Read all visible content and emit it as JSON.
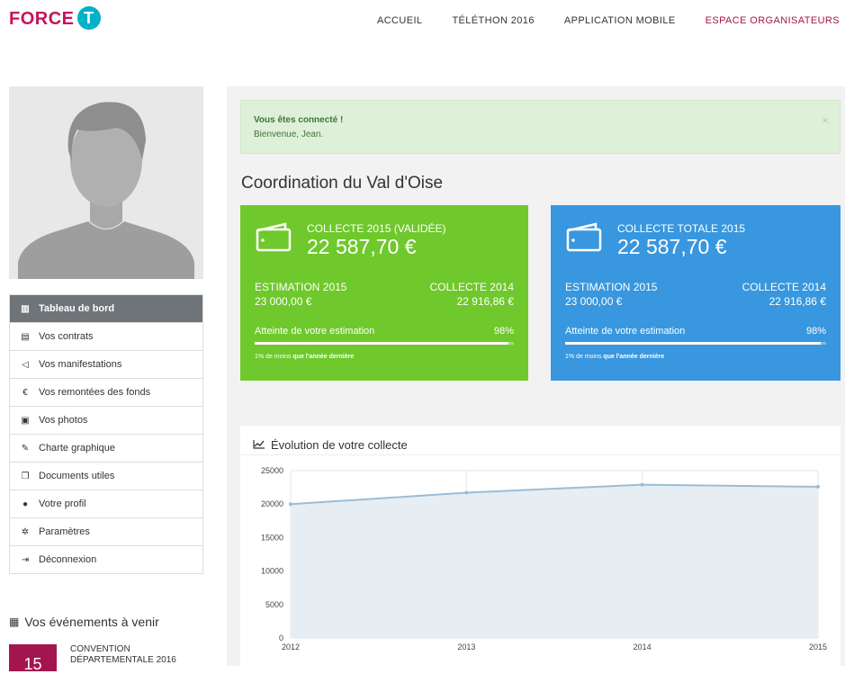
{
  "header": {
    "logo_text": "FORCE",
    "logo_badge": "T",
    "nav": [
      {
        "label": "ACCUEIL",
        "active": false
      },
      {
        "label": "TÉLÉTHON 2016",
        "active": false
      },
      {
        "label": "APPLICATION MOBILE",
        "active": false
      },
      {
        "label": "ESPACE ORGANISATEURS",
        "active": true
      }
    ]
  },
  "sidebar": {
    "menu": [
      {
        "label": "Tableau de bord",
        "icon": "bar-chart-icon",
        "active": true
      },
      {
        "label": "Vos contrats",
        "icon": "document-icon",
        "active": false
      },
      {
        "label": "Vos manifestations",
        "icon": "megaphone-icon",
        "active": false
      },
      {
        "label": "Vos remontées des fonds",
        "icon": "euro-icon",
        "active": false
      },
      {
        "label": "Vos photos",
        "icon": "image-icon",
        "active": false
      },
      {
        "label": "Charte graphique",
        "icon": "brush-icon",
        "active": false
      },
      {
        "label": "Documents utiles",
        "icon": "copy-icon",
        "active": false
      },
      {
        "label": "Votre profil",
        "icon": "user-icon",
        "active": false
      },
      {
        "label": "Paramètres",
        "icon": "gear-icon",
        "active": false
      },
      {
        "label": "Déconnexion",
        "icon": "logout-icon",
        "active": false
      }
    ],
    "events_title": "Vos événements à venir",
    "event": {
      "day": "15",
      "title_line1": "CONVENTION",
      "title_line2": "DÉPARTEMENTALE 2016"
    }
  },
  "main": {
    "alert": {
      "title": "Vous êtes connecté !",
      "message": "Bienvenue, Jean.",
      "close": "×"
    },
    "page_title": "Coordination du Val d'Oise",
    "cards": [
      {
        "label": "COLLECTE 2015 (VALIDÉE)",
        "amount": "22 587,70 €",
        "est_label": "ESTIMATION 2015",
        "est_value": "23 000,00 €",
        "prev_label": "COLLECTE 2014",
        "prev_value": "22 916,86 €",
        "att_label": "Atteinte de votre estimation",
        "att_pct": "98%",
        "progress": 0.98,
        "note_plain": "1% de moins ",
        "note_bold": "que l'année dernière"
      },
      {
        "label": "COLLECTE TOTALE 2015",
        "amount": "22 587,70 €",
        "est_label": "ESTIMATION 2015",
        "est_value": "23 000,00 €",
        "prev_label": "COLLECTE 2014",
        "prev_value": "22 916,86 €",
        "att_label": "Atteinte de votre estimation",
        "att_pct": "98%",
        "progress": 0.98,
        "note_plain": "1% de moins ",
        "note_bold": "que l'année dernière"
      }
    ],
    "chart_title": "Évolution de votre collecte"
  },
  "colors": {
    "brand": "#a4154f",
    "green": "#6fc82c",
    "blue": "#3897de",
    "line": "#9dbcd4",
    "area": "#e6eef3"
  },
  "chart_data": {
    "type": "area",
    "title": "Évolution de votre collecte",
    "x": [
      "2012",
      "2013",
      "2014",
      "2015"
    ],
    "series": [
      {
        "values": [
          20000,
          21700,
          22900,
          22590
        ]
      }
    ],
    "yticks": [
      0,
      5000,
      10000,
      15000,
      20000,
      25000
    ],
    "ylim": [
      0,
      25000
    ],
    "grid": true
  }
}
